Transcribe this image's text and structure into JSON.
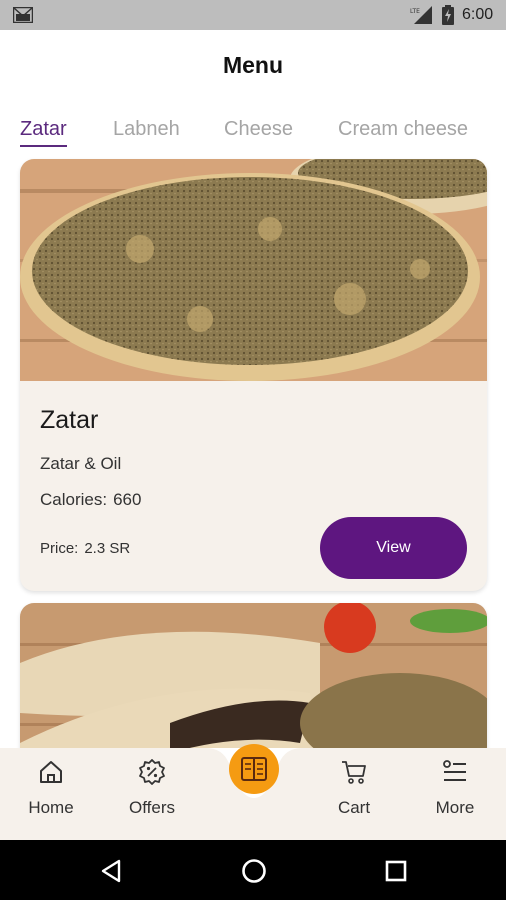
{
  "status_bar": {
    "time": "6:00",
    "notification_icon": "gmail-icon",
    "signal_icon": "cell-signal-icon",
    "battery_icon": "battery-icon"
  },
  "header": {
    "title": "Menu"
  },
  "tabs": [
    {
      "label": "Zatar",
      "active": true
    },
    {
      "label": "Labneh",
      "active": false
    },
    {
      "label": "Cheese",
      "active": false
    },
    {
      "label": "Cream cheese",
      "active": false
    }
  ],
  "items": [
    {
      "name": "Zatar",
      "description": "Zatar & Oil",
      "calories_label": "Calories:",
      "calories": "660",
      "price_label": "Price:",
      "price": "2.3 SR",
      "button_label": "View"
    }
  ],
  "bottom_nav": [
    {
      "label": "Home",
      "icon": "home-icon"
    },
    {
      "label": "Offers",
      "icon": "discount-icon"
    },
    {
      "label": "",
      "icon": "menu-book-icon"
    },
    {
      "label": "Cart",
      "icon": "cart-icon"
    },
    {
      "label": "More",
      "icon": "list-icon"
    }
  ],
  "colors": {
    "accent": "#5e1680",
    "tab_active": "#5b2a7e",
    "fab": "#f59b12",
    "card_bg": "#f6f1eb",
    "nav_bg": "#f6f1eb",
    "status_bar_bg": "#bdbdbd"
  },
  "system_nav": {
    "back_icon": "back-icon",
    "home_icon": "circle-home-icon",
    "recents_icon": "recents-icon"
  }
}
